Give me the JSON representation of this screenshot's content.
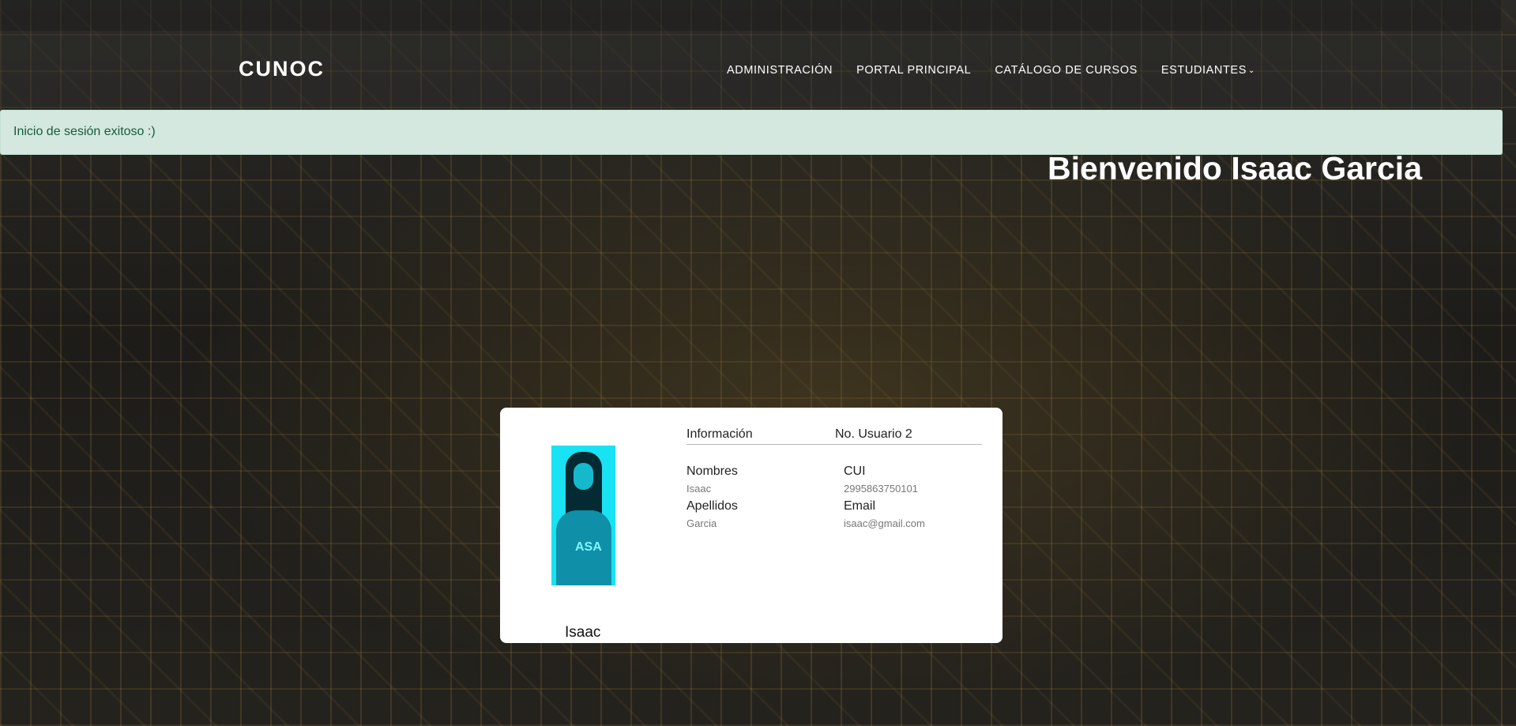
{
  "navbar": {
    "brand": "CUNOC",
    "links": [
      {
        "label": "ADMINISTRACIÓN"
      },
      {
        "label": "PORTAL PRINCIPAL"
      },
      {
        "label": "CATÁLOGO DE CURSOS"
      },
      {
        "label": "ESTUDIANTES",
        "chevron": "chevron-down-icon"
      }
    ]
  },
  "alert": {
    "message": "Inicio de sesión exitoso :)"
  },
  "welcome": {
    "text": "Bienvenido Isaac Garcia"
  },
  "profile": {
    "photo_text": "ASA",
    "name": "Isaac",
    "info_title": "Información",
    "user_number": "No. Usuario 2",
    "fields": {
      "nombres": {
        "label": "Nombres",
        "value": "Isaac"
      },
      "apellidos": {
        "label": "Apellidos",
        "value": "Garcia"
      },
      "cui": {
        "label": "CUI",
        "value": "2995863750101"
      },
      "email": {
        "label": "Email",
        "value": "isaac@gmail.com"
      }
    }
  },
  "colors": {
    "alert_bg": "#d4e8df",
    "alert_text": "#155d3a",
    "photo_bg": "#19e2f3"
  }
}
